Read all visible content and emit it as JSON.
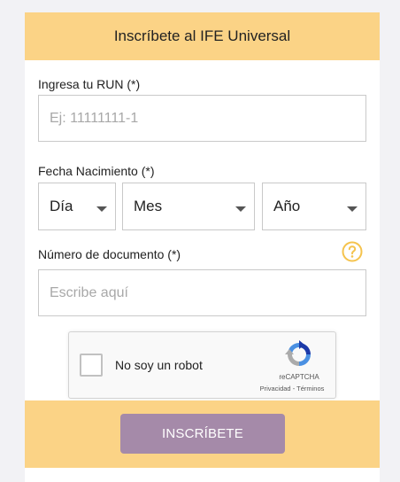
{
  "header": {
    "title": "Inscríbete al IFE Universal"
  },
  "form": {
    "run": {
      "label": "Ingresa tu RUN (*)",
      "placeholder": "Ej: 11111111-1",
      "value": ""
    },
    "birthdate": {
      "label": "Fecha Nacimiento (*)",
      "day": "Día",
      "month": "Mes",
      "year": "Año"
    },
    "document": {
      "label": "Número de documento (*)",
      "placeholder": "Escribe aquí",
      "value": "",
      "help_icon": "question-circle-icon"
    }
  },
  "recaptcha": {
    "label": "No soy un robot",
    "brand": "reCAPTCHA",
    "privacy": "Privacidad",
    "separator": " - ",
    "terms": "Términos"
  },
  "submit": {
    "label": "INSCRÍBETE"
  },
  "colors": {
    "header_bg": "#fbd386",
    "footer_bg": "#fbd386",
    "button_bg": "#a58aa9",
    "help_icon": "#f5c34d",
    "page_bg": "#f2f2f5"
  }
}
